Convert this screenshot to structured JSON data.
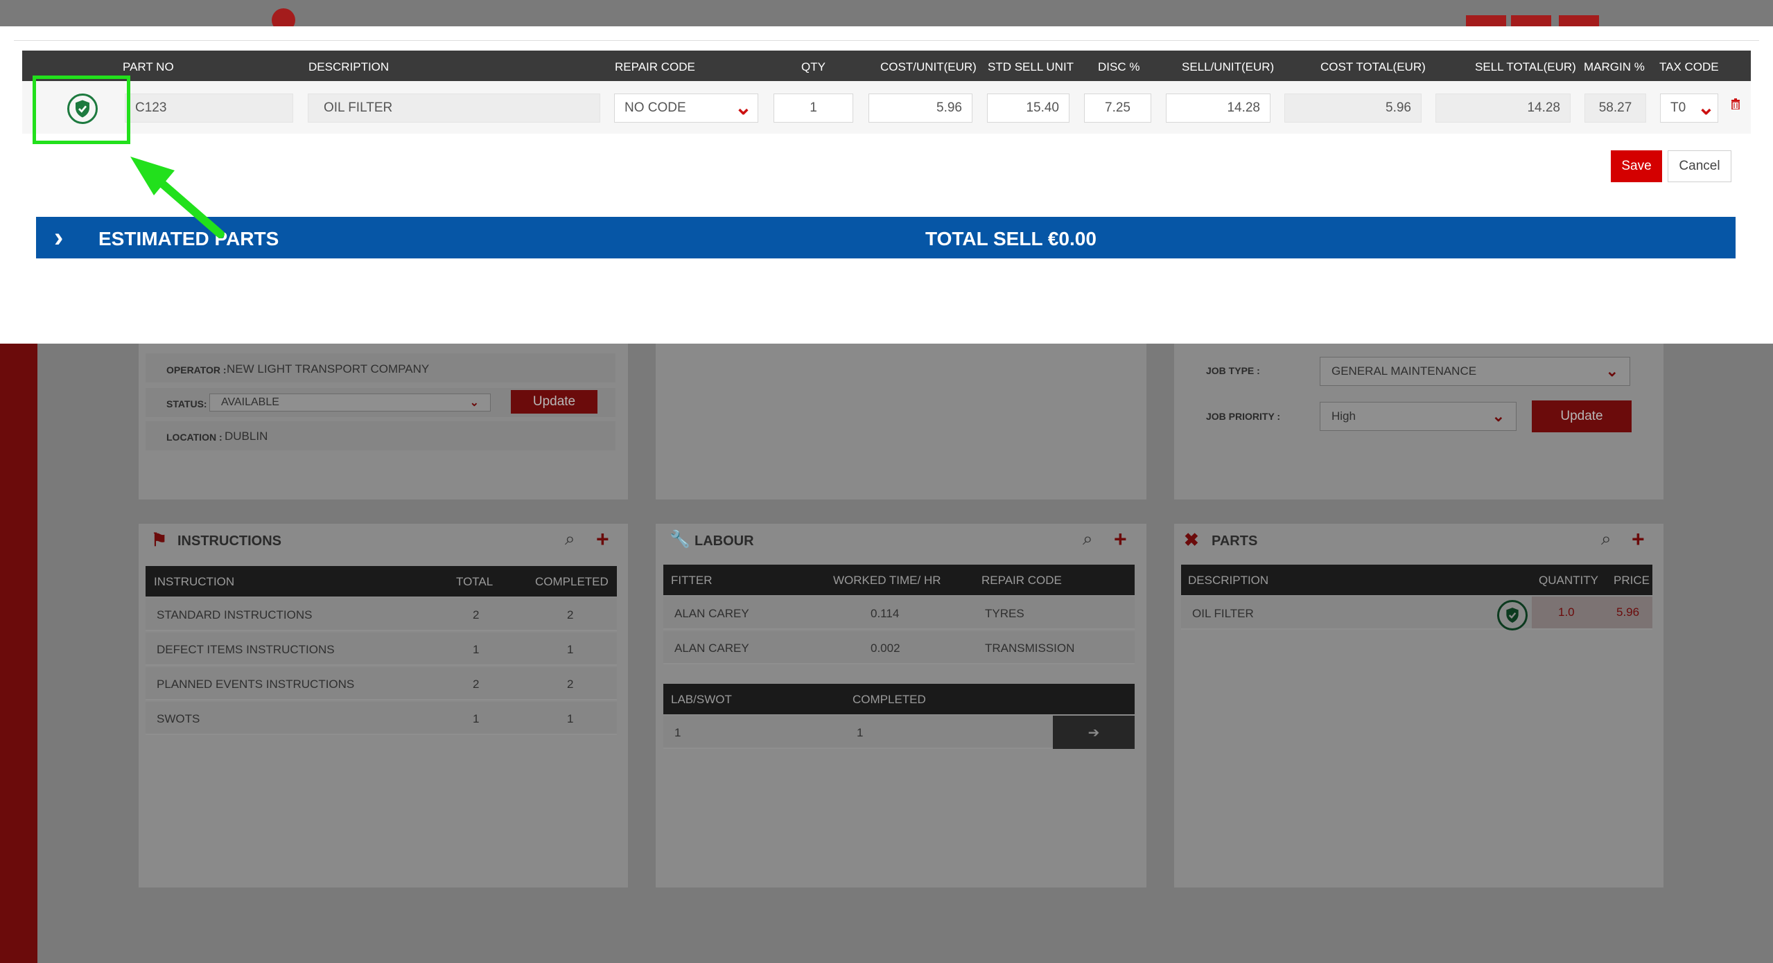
{
  "background": {
    "vehicle": {
      "operator_label": "OPERATOR :",
      "operator_value": "NEW LIGHT TRANSPORT COMPANY",
      "status_label": "STATUS:",
      "status_value": "AVAILABLE",
      "update_label": "Update",
      "location_label": "LOCATION :",
      "location_value": "DUBLIN"
    },
    "job": {
      "job_type_label": "JOB TYPE :",
      "job_type_value": "GENERAL MAINTENANCE",
      "job_priority_label": "JOB PRIORITY :",
      "job_priority_value": "High",
      "update_label": "Update"
    },
    "instructions": {
      "title": "INSTRUCTIONS",
      "columns": [
        "INSTRUCTION",
        "TOTAL",
        "COMPLETED"
      ],
      "rows": [
        [
          "STANDARD INSTRUCTIONS",
          "2",
          "2"
        ],
        [
          "DEFECT ITEMS INSTRUCTIONS",
          "1",
          "1"
        ],
        [
          "PLANNED EVENTS INSTRUCTIONS",
          "2",
          "2"
        ],
        [
          "SWOTS",
          "1",
          "1"
        ]
      ]
    },
    "labour": {
      "title": "LABOUR",
      "columns": [
        "FITTER",
        "WORKED TIME/ HR",
        "REPAIR CODE"
      ],
      "rows": [
        [
          "ALAN CAREY",
          "0.114",
          "TYRES"
        ],
        [
          "ALAN CAREY",
          "0.002",
          "TRANSMISSION"
        ]
      ],
      "swot_columns": [
        "LAB/SWOT",
        "COMPLETED"
      ],
      "swot_rows": [
        [
          "1",
          "1"
        ]
      ]
    },
    "parts": {
      "title": "PARTS",
      "columns": [
        "DESCRIPTION",
        "QUANTITY",
        "PRICE"
      ],
      "rows": [
        [
          "OIL FILTER",
          "1.0",
          "5.96"
        ]
      ]
    }
  },
  "modal": {
    "columns": [
      "PART NO",
      "DESCRIPTION",
      "REPAIR CODE",
      "QTY",
      "COST/UNIT(EUR)",
      "STD SELL UNIT",
      "DISC %",
      "SELL/UNIT(EUR)",
      "COST TOTAL(EUR)",
      "SELL TOTAL(EUR)",
      "MARGIN %",
      "TAX CODE"
    ],
    "row": {
      "part_no": "C123",
      "description": "OIL FILTER",
      "repair_code": "NO CODE",
      "qty": "1",
      "cost_unit": "5.96",
      "std_sell_unit": "15.40",
      "disc": "7.25",
      "sell_unit": "14.28",
      "cost_total": "5.96",
      "sell_total": "14.28",
      "margin": "58.27",
      "tax_code": "T0"
    },
    "save_label": "Save",
    "cancel_label": "Cancel",
    "estimated_parts_label": "ESTIMATED PARTS",
    "total_sell_label": "TOTAL SELL €0.00"
  },
  "colors": {
    "accent_red": "#d40000",
    "bar_blue": "#0656a6",
    "annotation_green": "#22e01c"
  }
}
